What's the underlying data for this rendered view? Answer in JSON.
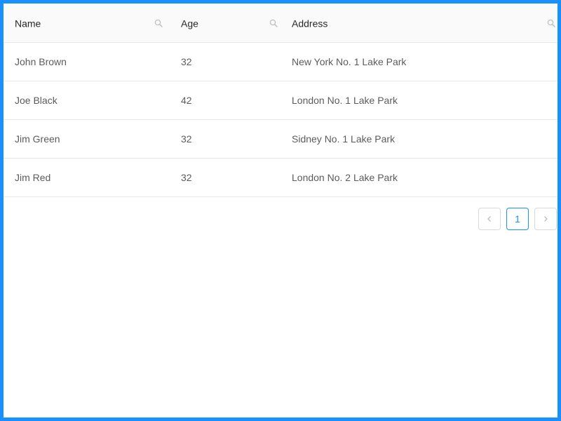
{
  "table": {
    "columns": [
      {
        "label": "Name",
        "filter_icon": "search-icon"
      },
      {
        "label": "Age",
        "filter_icon": "search-icon"
      },
      {
        "label": "Address",
        "filter_icon": "search-icon"
      }
    ],
    "rows": [
      {
        "name": "John Brown",
        "age": "32",
        "address": "New York No. 1 Lake Park"
      },
      {
        "name": "Joe Black",
        "age": "42",
        "address": "London No. 1 Lake Park"
      },
      {
        "name": "Jim Green",
        "age": "32",
        "address": "Sidney No. 1 Lake Park"
      },
      {
        "name": "Jim Red",
        "age": "32",
        "address": "London No. 2 Lake Park"
      }
    ]
  },
  "pagination": {
    "prev_icon": "chevron-left-icon",
    "current_page": "1",
    "next_icon": "chevron-right-icon"
  },
  "colors": {
    "frame": "#1890ff",
    "active_page": "#1890ff",
    "header_bg": "#fafafa",
    "row_border": "#e8e8e8"
  }
}
